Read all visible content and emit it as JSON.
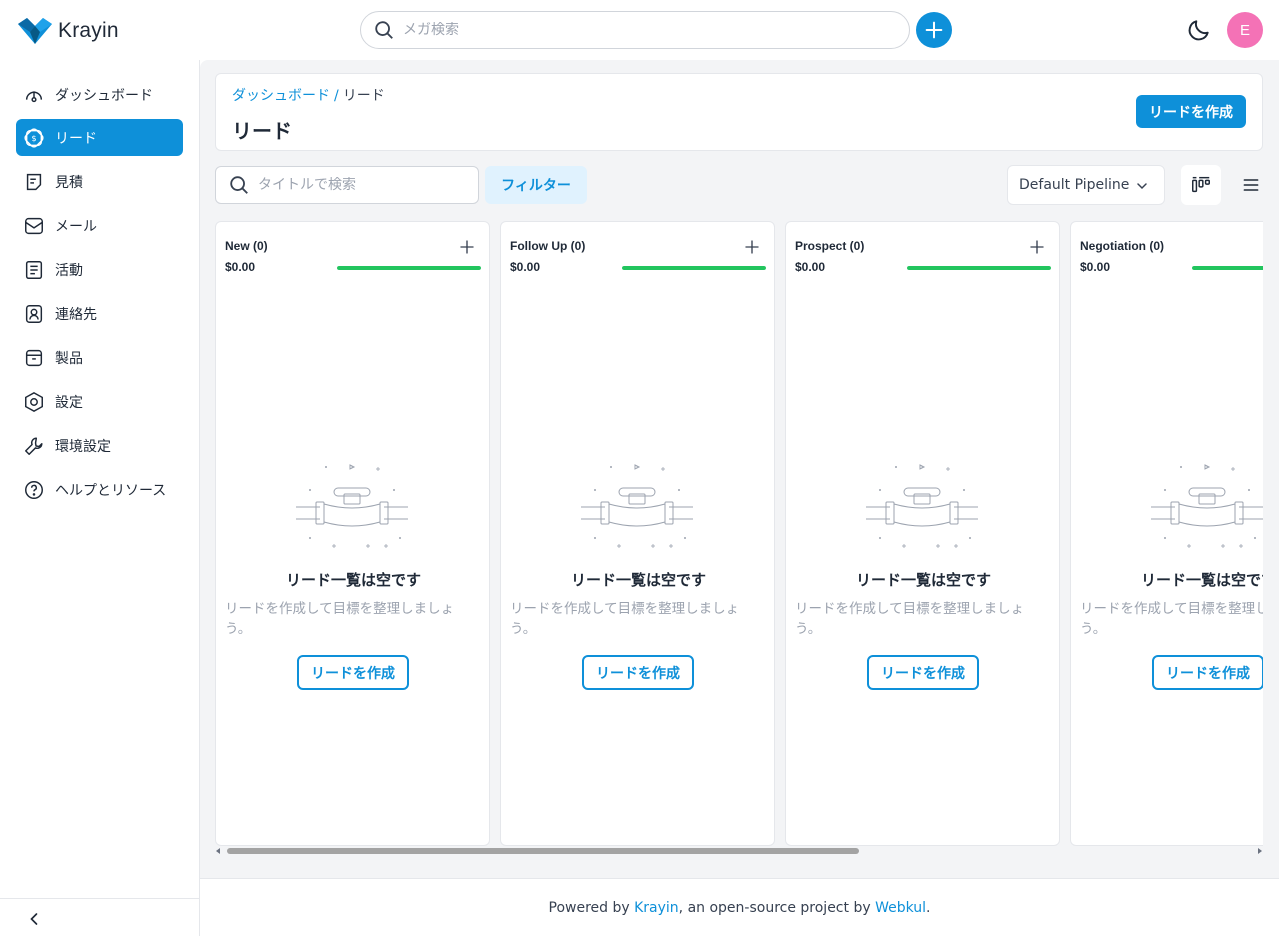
{
  "header": {
    "logo_text": "Krayin",
    "search_placeholder": "メガ検索",
    "avatar_initial": "E",
    "accent": "#0e90d9",
    "avatar_color": "#f472b6"
  },
  "sidebar": {
    "items": [
      {
        "label": "ダッシュボード",
        "icon": "dashboard-icon"
      },
      {
        "label": "リード",
        "icon": "leads-icon",
        "active": true
      },
      {
        "label": "見積",
        "icon": "quotes-icon"
      },
      {
        "label": "メール",
        "icon": "mail-icon"
      },
      {
        "label": "活動",
        "icon": "activities-icon"
      },
      {
        "label": "連絡先",
        "icon": "contacts-icon"
      },
      {
        "label": "製品",
        "icon": "products-icon"
      },
      {
        "label": "設定",
        "icon": "settings-icon"
      },
      {
        "label": "環境設定",
        "icon": "configuration-icon"
      },
      {
        "label": "ヘルプとリソース",
        "icon": "help-icon"
      }
    ]
  },
  "page": {
    "breadcrumb_home": "ダッシュボード",
    "breadcrumb_sep": "/",
    "breadcrumb_current": "リード",
    "title": "リード",
    "create_button": "リードを作成"
  },
  "toolbar": {
    "search_placeholder": "タイトルで検索",
    "filter_label": "フィルター",
    "pipeline": "Default Pipeline"
  },
  "board": {
    "columns": [
      {
        "title": "New (0)",
        "amount": "$0.00",
        "progress": 1.0
      },
      {
        "title": "Follow Up (0)",
        "amount": "$0.00",
        "progress": 1.0
      },
      {
        "title": "Prospect (0)",
        "amount": "$0.00",
        "progress": 1.0
      },
      {
        "title": "Negotiation (0)",
        "amount": "$0.00",
        "progress": 1.0
      }
    ],
    "empty_title": "リード一覧は空です",
    "empty_desc": "リードを作成して目標を整理しましょう。",
    "empty_button": "リードを作成"
  },
  "footer": {
    "prefix": "Powered by ",
    "link1": "Krayin",
    "middle": ", an open-source project by ",
    "link2": "Webkul",
    "suffix": "."
  }
}
